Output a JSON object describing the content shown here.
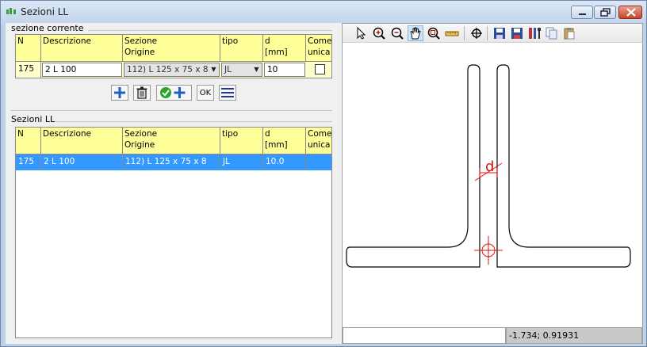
{
  "window": {
    "title": "Sezioni LL"
  },
  "current_section": {
    "group_label": "sezione corrente",
    "columns": {
      "n": "N",
      "descrizione": "Descrizione",
      "sezione_l1": "Sezione",
      "sezione_l2": "Origine",
      "tipo": "tipo",
      "d_l1": "d",
      "d_l2": "[mm]",
      "come_l1": "Come",
      "come_l2": "unica"
    },
    "row": {
      "n": "175",
      "descrizione": "2 L 100",
      "sezione_origine": "112) L 125 x 75 x 8",
      "tipo": "JL",
      "d": "10",
      "come_unica": false
    }
  },
  "list_section": {
    "group_label": "Sezioni LL",
    "columns": {
      "n": "N",
      "descrizione": "Descrizione",
      "sezione_l1": "Sezione",
      "sezione_l2": "Origine",
      "tipo": "tipo",
      "d_l1": "d",
      "d_l2": "[mm]",
      "come_l1": "Come",
      "come_l2": "unica"
    },
    "rows": [
      {
        "n": "175",
        "descrizione": "2 L 100",
        "sezione_origine": "112) L 125 x 75 x 8",
        "tipo": "JL",
        "d": "10.0",
        "come_unica": "",
        "selected": true
      }
    ]
  },
  "buttons": {
    "ok_label": "OK"
  },
  "drawing": {
    "d_label": "d"
  },
  "status": {
    "left": "",
    "coordinates": "-1.734; 0.91931"
  },
  "colors": {
    "header_bg": "#ffff99",
    "selection": "#3399ff",
    "drawing_red": "#e01010"
  }
}
